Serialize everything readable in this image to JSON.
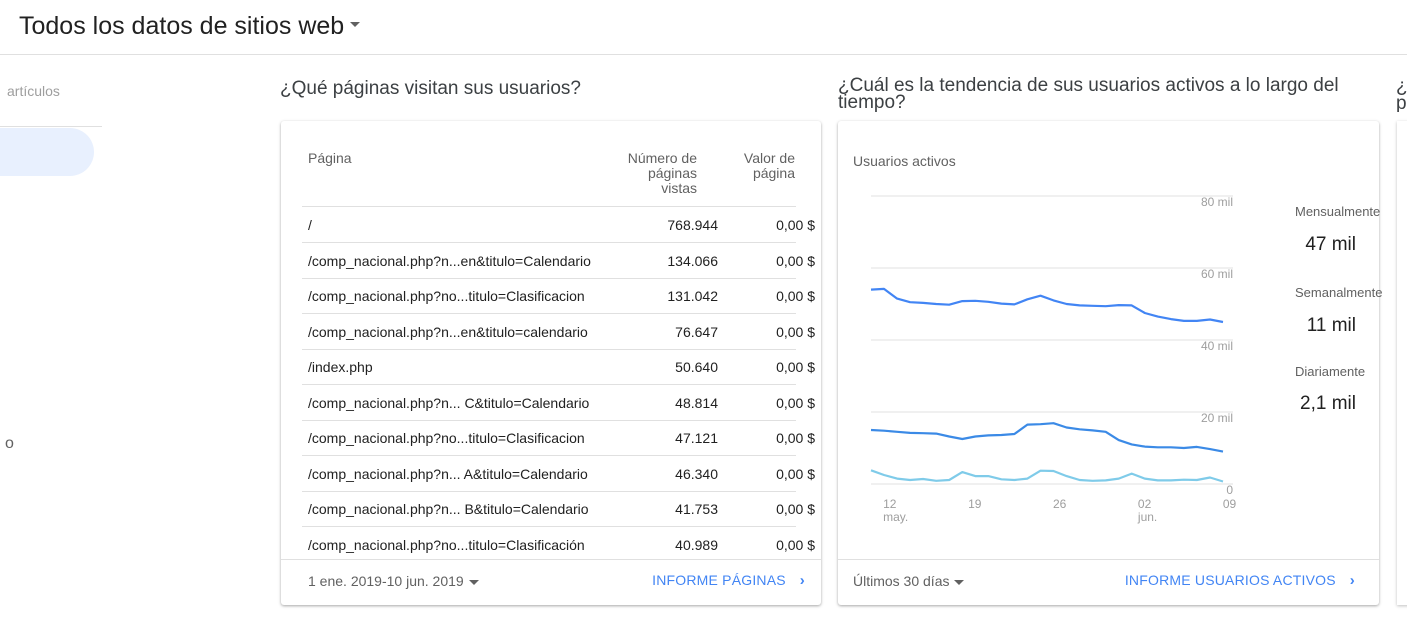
{
  "header": {
    "title": "Todos los datos de sitios web"
  },
  "left_panel": {
    "label": "artículos",
    "stray_char": "o"
  },
  "pages_card": {
    "question": "¿Qué páginas visitan sus usuarios?",
    "col_page": "Página",
    "col_views": [
      "Número de",
      "páginas",
      "vistas"
    ],
    "col_value": [
      "Valor de",
      "página"
    ],
    "rows": [
      {
        "page": "/",
        "views": "768.944",
        "value": "0,00 $"
      },
      {
        "page": "/comp_nacional.php?n...en&titulo=Calendario",
        "views": "134.066",
        "value": "0,00 $"
      },
      {
        "page": "/comp_nacional.php?no...titulo=Clasificacion",
        "views": "131.042",
        "value": "0,00 $"
      },
      {
        "page": "/comp_nacional.php?n...en&titulo=calendario",
        "views": "76.647",
        "value": "0,00 $"
      },
      {
        "page": "/index.php",
        "views": "50.640",
        "value": "0,00 $"
      },
      {
        "page": "/comp_nacional.php?n... C&titulo=Calendario",
        "views": "48.814",
        "value": "0,00 $"
      },
      {
        "page": "/comp_nacional.php?no...titulo=Clasificacion",
        "views": "47.121",
        "value": "0,00 $"
      },
      {
        "page": "/comp_nacional.php?n... A&titulo=Calendario",
        "views": "46.340",
        "value": "0,00 $"
      },
      {
        "page": "/comp_nacional.php?n... B&titulo=Calendario",
        "views": "41.753",
        "value": "0,00 $"
      },
      {
        "page": "/comp_nacional.php?no...titulo=Clasificación",
        "views": "40.989",
        "value": "0,00 $"
      }
    ],
    "date_range": "1 ene. 2019-10 jun. 2019",
    "report_link": "INFORME PÁGINAS"
  },
  "users_card": {
    "question": "¿Cuál es la tendencia de sus usuarios activos a lo largo del tiempo?",
    "chart_title": "Usuarios activos",
    "period": "Últimos 30 días",
    "report_link": "INFORME USUARIOS ACTIVOS",
    "metrics": [
      {
        "label": "Mensualmente",
        "value": "47 mil"
      },
      {
        "label": "Semanalmente",
        "value": "11 mil"
      },
      {
        "label": "Diariamente",
        "value": "2,1 mil"
      }
    ]
  },
  "next_card": {
    "question_fragment": "¿ p"
  },
  "colors": {
    "accent": "#4285f4",
    "monthly": "#4285f4",
    "weekly": "#3b8ae6",
    "daily": "#7fcbe9"
  },
  "chart_data": {
    "type": "line",
    "title": "Usuarios activos",
    "x_ticks": [
      "12\nmay.",
      "19",
      "26",
      "02\njun.",
      "09"
    ],
    "y_ticks": [
      "80 mil",
      "60 mil",
      "40 mil",
      "20 mil",
      "0"
    ],
    "ylim": [
      0,
      80000
    ],
    "x_start": "2019-05-11",
    "series": [
      {
        "name": "Mensualmente",
        "values": [
          54000,
          54200,
          51500,
          50500,
          50300,
          50000,
          49800,
          50800,
          50900,
          50600,
          50100,
          49900,
          51300,
          52300,
          51000,
          50000,
          49600,
          49500,
          49400,
          49700,
          49600,
          47500,
          46500,
          45800,
          45300,
          45300,
          45700,
          45000
        ]
      },
      {
        "name": "Semanalmente",
        "values": [
          15000,
          14800,
          14500,
          14200,
          14100,
          14000,
          13200,
          12500,
          13200,
          13500,
          13600,
          13900,
          16500,
          16600,
          16900,
          15700,
          15200,
          14900,
          14500,
          12200,
          11000,
          10400,
          10200,
          10200,
          10000,
          10300,
          9700,
          9000
        ]
      },
      {
        "name": "Diariamente",
        "values": [
          3800,
          2500,
          1500,
          1100,
          1400,
          900,
          1100,
          3300,
          2200,
          2200,
          1300,
          1100,
          1500,
          3700,
          3600,
          2200,
          1100,
          900,
          1000,
          1500,
          2900,
          1500,
          1000,
          1000,
          1200,
          1100,
          1800,
          700
        ]
      }
    ]
  }
}
